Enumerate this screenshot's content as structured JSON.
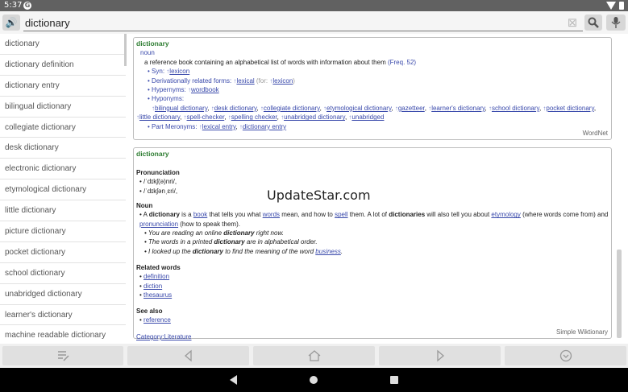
{
  "status_bar": {
    "time": "5:37",
    "app_badge": "G"
  },
  "search": {
    "query": "dictionary"
  },
  "sidebar": {
    "items": [
      "dictionary",
      "dictionary definition",
      "dictionary entry",
      "bilingual dictionary",
      "collegiate dictionary",
      "desk dictionary",
      "electronic dictionary",
      "etymological dictionary",
      "little dictionary",
      "picture dictionary",
      "pocket dictionary",
      "school dictionary",
      "unabridged dictionary",
      "learner's dictionary",
      "machine readable dictionary"
    ]
  },
  "wordnet": {
    "headword": "dictionary",
    "pos": "noun",
    "definition": "a reference book containing an alphabetical list of words with information about them",
    "freq_label": "(Freq. 52)",
    "syn_label": "Syn:",
    "syn_link": "lexicon",
    "derived_label": "Derivationally related forms:",
    "derived_link": "lexical",
    "derived_for": "(for:",
    "derived_for_link": "lexicon",
    "derived_close": ")",
    "hypernyms_label": "Hypernyms:",
    "hypernym_link": "wordbook",
    "hyponyms_label": "Hyponyms:",
    "hyponyms": [
      "bilingual dictionary",
      "desk dictionary",
      "collegiate dictionary",
      "etymological dictionary",
      "gazetteer",
      "learner's dictionary",
      "school dictionary",
      "pocket dictionary",
      "little dictionary",
      "spell-checker",
      "spelling checker",
      "unabridged dictionary",
      "unabridged"
    ],
    "meronyms_label": "Part Meronyms:",
    "meronyms": [
      "lexical entry",
      "dictionary entry"
    ],
    "source": "WordNet"
  },
  "wiktionary": {
    "headword": "dictionary",
    "pronunciation_heading": "Pronunciation",
    "pron1": "/ˈdɪkʃ(ə)nri/,",
    "pron2": "/ˈdɪkʃənˌɛri/,",
    "noun_heading": "Noun",
    "noun_def": {
      "p1": "A ",
      "b1": "dictionary",
      "p2": " is a ",
      "l1": "book",
      "p3": " that tells you what ",
      "l2": "words",
      "p4": " mean, and how to ",
      "l3": "spell",
      "p5": " them. A lot of ",
      "b2": "dictionaries",
      "p6": " will also tell you about ",
      "l4": "etymology",
      "p7": " (where words come from) and ",
      "l5": "pronunciation",
      "p8": " (how to speak them)."
    },
    "ex1": {
      "a": "You are reading an online ",
      "b": "dictionary",
      "c": " right now."
    },
    "ex2": {
      "a": "The words in a printed ",
      "b": "dictionary",
      "c": " are in alphabetical order."
    },
    "ex3": {
      "a": "I looked up the ",
      "b": "dictionary",
      "c": " to find the meaning of the word ",
      "d": "business",
      "e": "."
    },
    "related_heading": "Related words",
    "related": [
      "definition",
      "diction",
      "thesaurus"
    ],
    "seealso_heading": "See also",
    "seealso": [
      "reference"
    ],
    "category": "Category:Literature",
    "source": "Simple Wiktionary"
  },
  "watermark": "UpdateStar.com"
}
